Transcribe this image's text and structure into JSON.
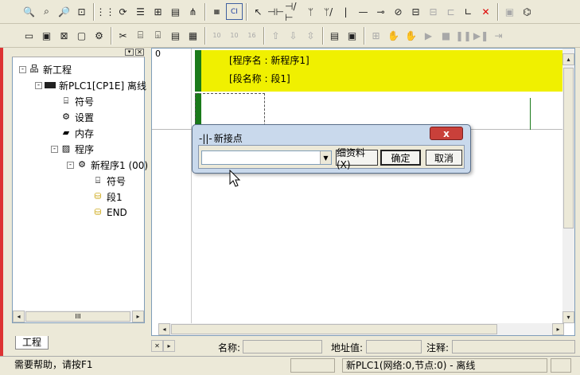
{
  "toolbar1": {
    "buttons": [
      "zoom-in-icon",
      "zoom-icon",
      "zoom-out-icon",
      "zoom-fit-icon",
      "grid-icon",
      "cross-ref-icon",
      "list-icon",
      "network-icon",
      "ladder-icon",
      "tree-icon",
      "mem-icon",
      "ci-icon",
      "pointer-icon",
      "no-contact-icon",
      "nc-contact-icon",
      "or-contact-icon",
      "or-nc-icon",
      "vline-icon",
      "hline-icon",
      "coil-icon",
      "nc-coil-icon",
      "instr-icon",
      "lr-icon",
      "rr-icon",
      "line-draw-icon",
      "delete-line-icon",
      "online-icon",
      "compare-icon"
    ]
  },
  "toolbar2": {
    "numbers": [
      "10",
      "10",
      "16"
    ]
  },
  "project_tree": {
    "root": "新工程",
    "plc": "新PLC1[CP1E] 离线",
    "symbols": "符号",
    "settings": "设置",
    "memory": "内存",
    "programs": "程序",
    "program1": "新程序1 (00)",
    "prog_symbols": "符号",
    "section1": "段1",
    "end": "END",
    "tab_label": "工程",
    "scroll_mark": "III"
  },
  "editor": {
    "rung_number": "0",
    "program_name_line": "[程序名 : 新程序1]",
    "section_name_line": "[段名称 : 段1]"
  },
  "dialog": {
    "title": "新接点",
    "input_value": "",
    "detail_button": "细资料(X)",
    "ok_button": "确定",
    "cancel_button": "取消",
    "close_glyph": "x"
  },
  "info_bar": {
    "name_label": "名称:",
    "address_label": "地址值:",
    "comment_label": "注释:"
  },
  "status_bar": {
    "help_text": "需要帮助，请按F1",
    "plc_status": "新PLC1(网络:0,节点:0) - 离线"
  }
}
